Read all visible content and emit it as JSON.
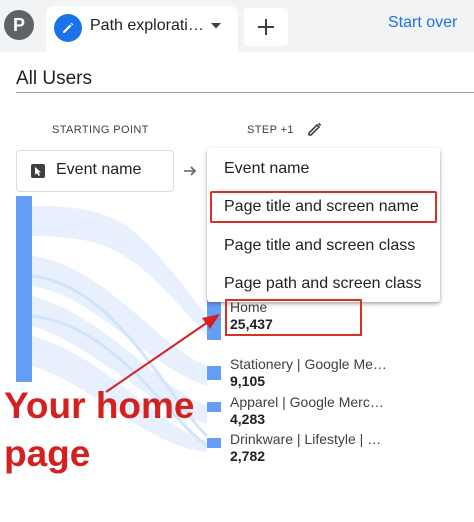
{
  "tabs": {
    "avatar_letter": "P",
    "active_label": "Path explorati…",
    "new_tab_symbol": "+",
    "start_over_label": "Start over"
  },
  "segment": {
    "title": "All Users"
  },
  "columns": {
    "starting_point": "STARTING POINT",
    "step": "STEP +1"
  },
  "start_select": {
    "value": "Event name"
  },
  "menu": {
    "items": [
      {
        "label": "Event name",
        "highlighted": false
      },
      {
        "label": "Page title and screen name",
        "highlighted": true
      },
      {
        "label": "Page title and screen class",
        "highlighted": false
      },
      {
        "label": "Page path and screen class",
        "highlighted": false
      }
    ]
  },
  "nodes": [
    {
      "name": "Home",
      "value": "25,437"
    },
    {
      "name": "Stationery | Google Me…",
      "value": "9,105"
    },
    {
      "name": "Apparel | Google Merc…",
      "value": "4,283"
    },
    {
      "name": "Drinkware | Lifestyle | …",
      "value": "2,782"
    }
  ],
  "annotation": {
    "line1": "Your home",
    "line2": "page"
  },
  "colors": {
    "accent": "#1a73e8",
    "flow_node": "#669df6",
    "highlight_red": "#d93025",
    "annotation_red": "#d42120"
  }
}
